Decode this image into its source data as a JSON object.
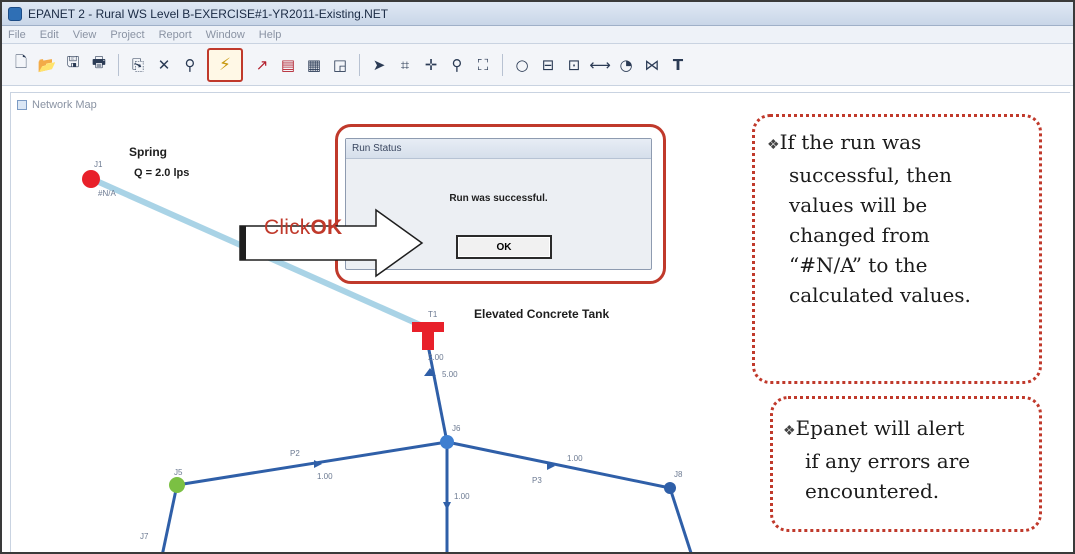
{
  "window": {
    "title": "EPANET 2 - Rural WS Level B-EXERCISE#1-YR2011-Existing.NET"
  },
  "menu": {
    "items": [
      "File",
      "Edit",
      "View",
      "Project",
      "Report",
      "Window",
      "Help"
    ]
  },
  "toolbar": {
    "icons": [
      "new-icon",
      "open-icon",
      "save-icon",
      "print-icon",
      "copy-icon",
      "delete-icon",
      "find-icon",
      "run-icon",
      "graph-icon",
      "table-icon",
      "report-icon",
      "options-icon",
      "select-icon",
      "vertex-icon",
      "pan-icon",
      "zoom-icon",
      "full-extent-icon",
      "junction-icon",
      "reservoir-icon",
      "tank-icon",
      "pipe-icon",
      "pump-icon",
      "valve-icon",
      "text-icon"
    ],
    "text_tool_label": "T"
  },
  "network_map": {
    "title": "Network Map",
    "labels": {
      "spring": "Spring",
      "flow": "Q = 2.0 lps",
      "tank": "Elevated Concrete Tank",
      "tank_id": "T1",
      "node_j1": "J1",
      "node_j5": "J5",
      "node_j6": "J6",
      "node_j7": "J7",
      "node_j8": "J8",
      "pipe_p2": "P2",
      "pipe_p3": "P3",
      "tank_value": "2.00",
      "p1_value": "5.00",
      "j6_value": "1.00",
      "p3_value": "1.00",
      "mid_value": "1.00",
      "spring_value": "#N/A"
    },
    "colors": {
      "spring_node": "#e8202a",
      "tank": "#e8202a",
      "pipe_main": "#2f5fa8",
      "pipe_light": "#a9d3e6",
      "green_node": "#7bc043"
    }
  },
  "run_status_dialog": {
    "title": "Run Status",
    "message": "Run was successful.",
    "ok_label": "OK"
  },
  "annotation": {
    "click_prefix": "Click",
    "click_ok": "OK"
  },
  "callout_success": {
    "lines": [
      "If the run was",
      "successful, then",
      "values will be",
      "changed from",
      "“#N/A” to the",
      "calculated values."
    ]
  },
  "callout_errors": {
    "lines": [
      "Epanet will alert",
      "if any errors are",
      "encountered."
    ]
  }
}
